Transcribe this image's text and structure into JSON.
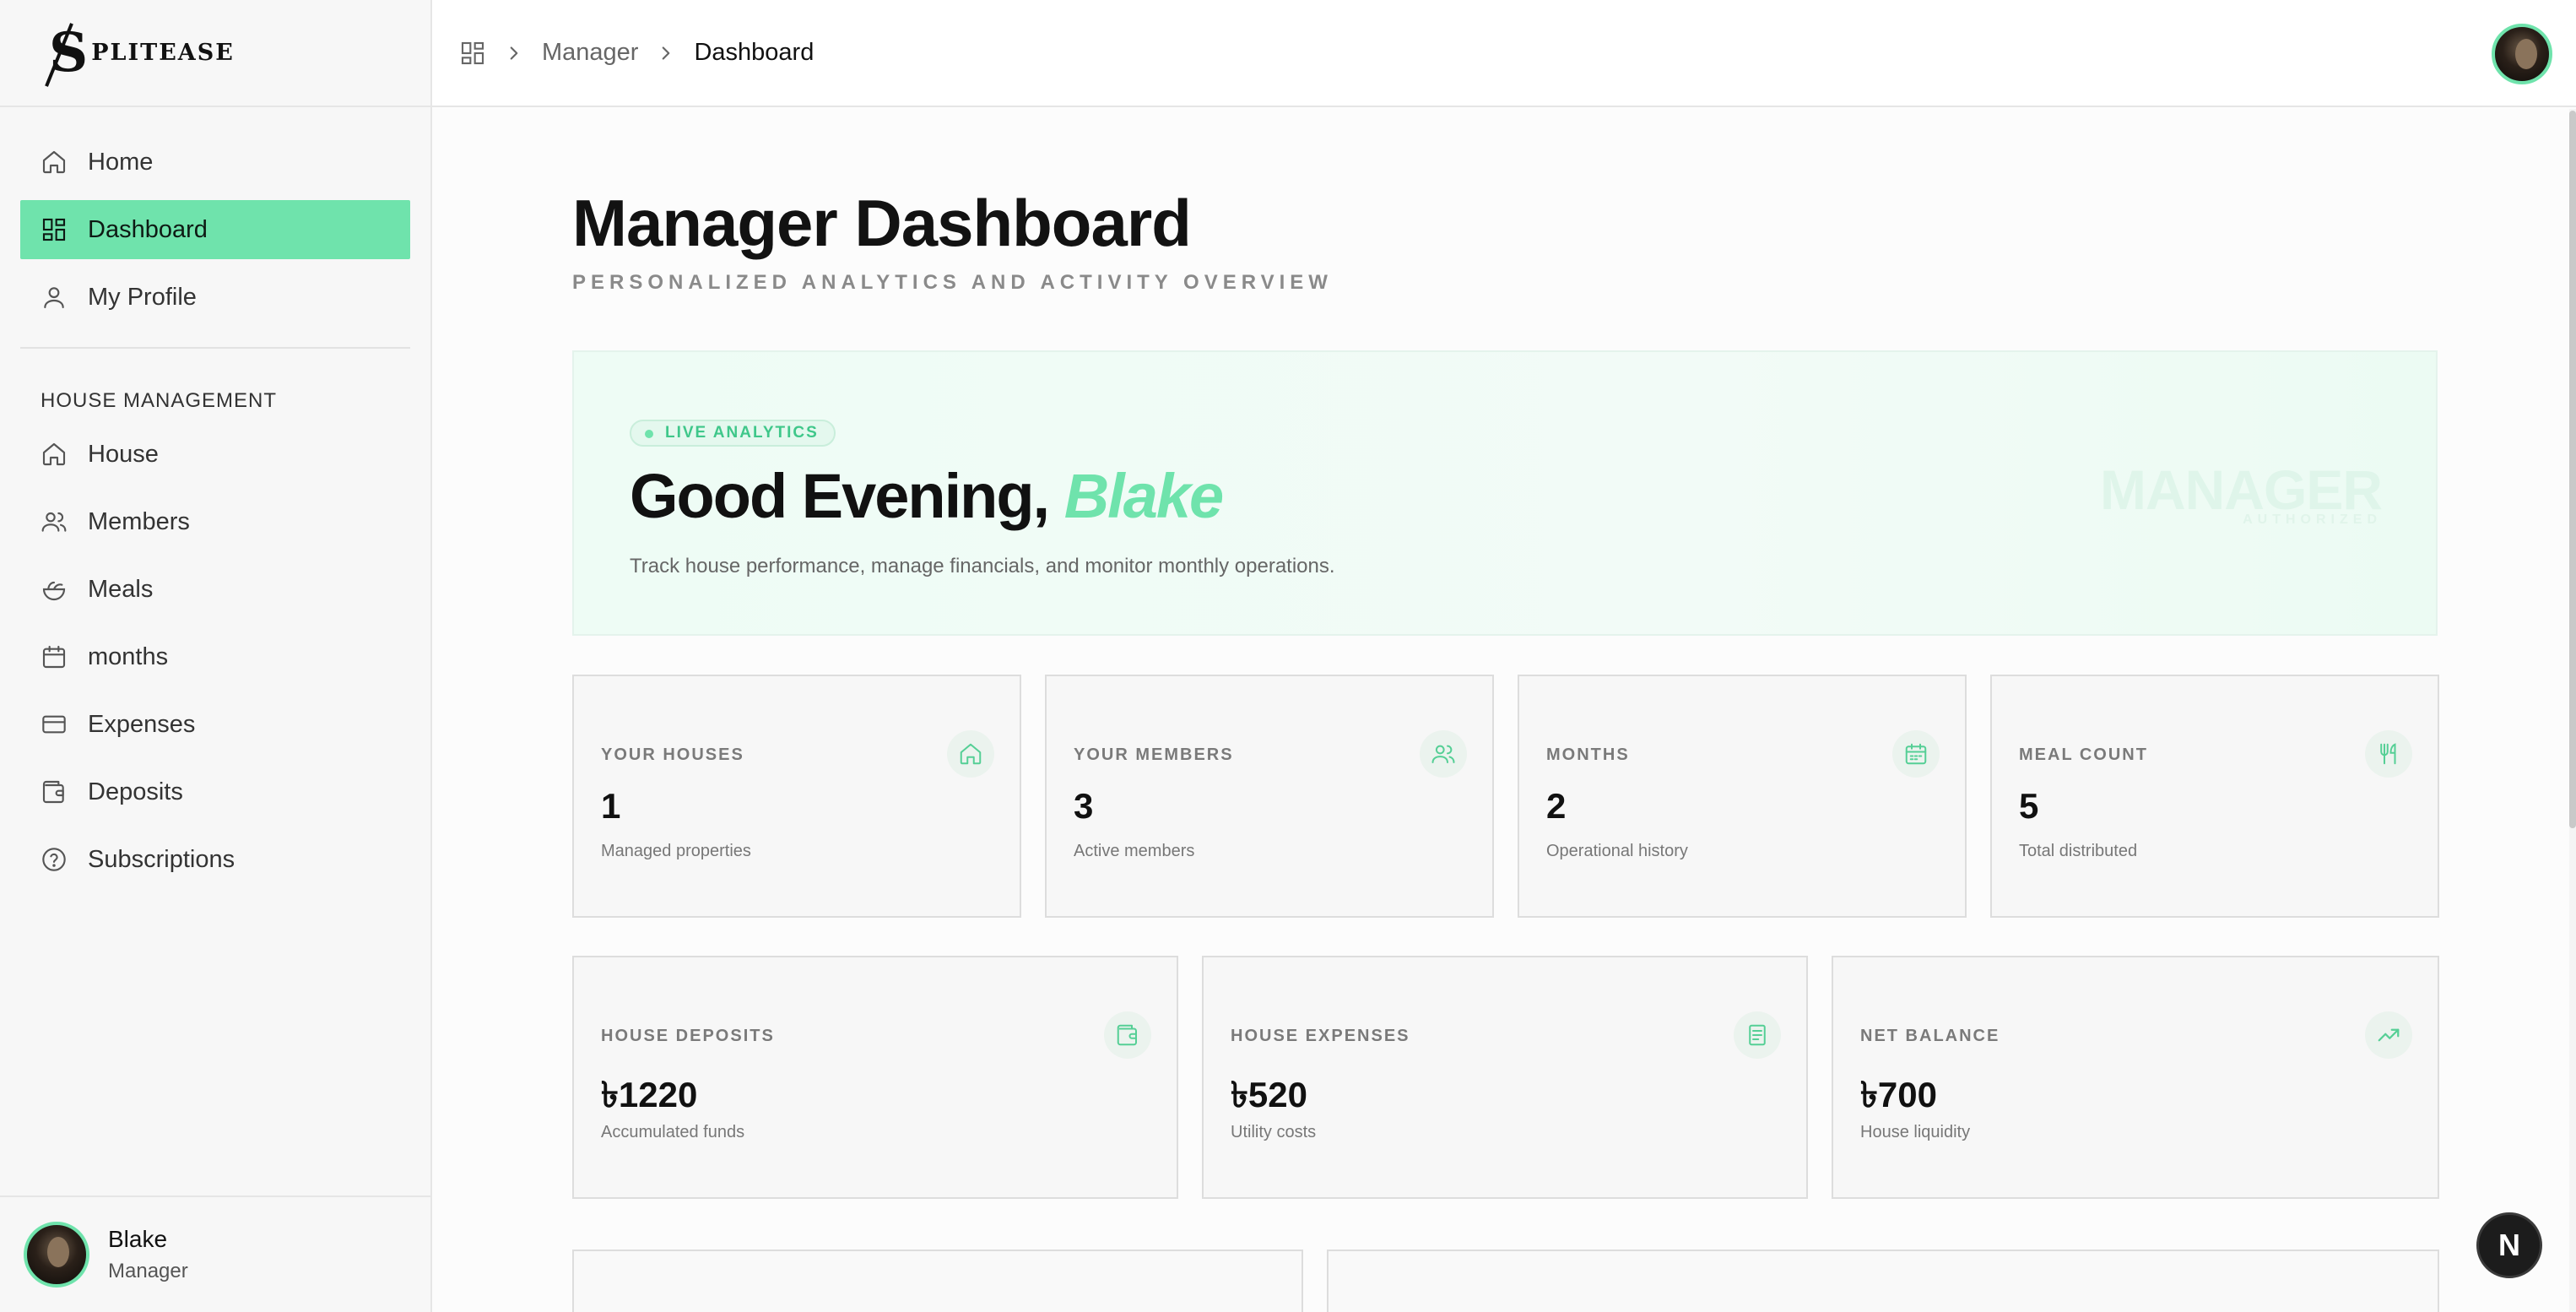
{
  "brand": {
    "logo_letter": "S",
    "logo_text": "PLITEASE"
  },
  "sidebar": {
    "main_items": [
      {
        "label": "Home",
        "icon": "home-icon"
      },
      {
        "label": "Dashboard",
        "icon": "dashboard-icon",
        "active": true
      },
      {
        "label": "My Profile",
        "icon": "user-icon"
      }
    ],
    "section_label": "HOUSE MANAGEMENT",
    "house_items": [
      {
        "label": "House",
        "icon": "home-icon"
      },
      {
        "label": "Members",
        "icon": "users-icon"
      },
      {
        "label": "Meals",
        "icon": "salad-icon"
      },
      {
        "label": "months",
        "icon": "calendar-icon"
      },
      {
        "label": "Expenses",
        "icon": "credit-card-icon"
      },
      {
        "label": "Deposits",
        "icon": "wallet-icon"
      },
      {
        "label": "Subscriptions",
        "icon": "help-circle-icon"
      }
    ],
    "user": {
      "name": "Blake",
      "role": "Manager"
    }
  },
  "breadcrumb": {
    "items": [
      "Manager",
      "Dashboard"
    ]
  },
  "page": {
    "title": "Manager Dashboard",
    "subtitle": "PERSONALIZED ANALYTICS AND ACTIVITY OVERVIEW"
  },
  "hero": {
    "badge": "LIVE ANALYTICS",
    "greeting": "Good Evening,",
    "name": "Blake",
    "description": "Track house performance, manage financials, and monitor monthly operations.",
    "watermark": "MANAGER",
    "watermark_sub": "AUTHORIZED"
  },
  "stats": [
    {
      "label": "YOUR HOUSES",
      "value": "1",
      "desc": "Managed properties",
      "icon": "home-icon"
    },
    {
      "label": "YOUR MEMBERS",
      "value": "3",
      "desc": "Active members",
      "icon": "users-icon"
    },
    {
      "label": "MONTHS",
      "value": "2",
      "desc": "Operational history",
      "icon": "calendar-icon"
    },
    {
      "label": "MEAL COUNT",
      "value": "5",
      "desc": "Total distributed",
      "icon": "utensils-icon"
    }
  ],
  "finance": [
    {
      "label": "HOUSE DEPOSITS",
      "value": "৳1220",
      "desc": "Accumulated funds",
      "icon": "wallet-icon"
    },
    {
      "label": "HOUSE EXPENSES",
      "value": "৳520",
      "desc": "Utility costs",
      "icon": "receipt-icon"
    },
    {
      "label": "NET BALANCE",
      "value": "৳700",
      "desc": "House liquidity",
      "icon": "trending-up-icon"
    }
  ],
  "fab": {
    "label": "N"
  },
  "colors": {
    "accent": "#6fe3ac",
    "accent_dark": "#3fc78a",
    "text": "#111111",
    "muted": "#7a7a7a"
  }
}
